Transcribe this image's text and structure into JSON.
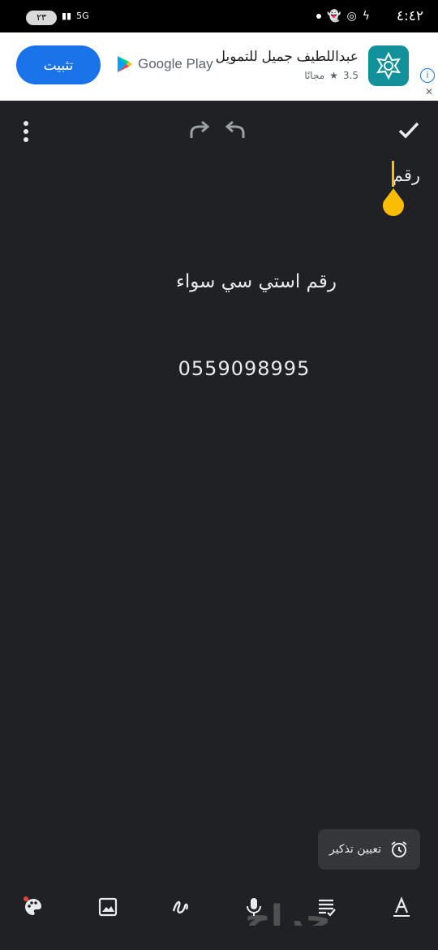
{
  "status_bar": {
    "time": "٤:٤٢",
    "battery": "٢٣",
    "network": "5G"
  },
  "ad": {
    "install_label": "تثبيت",
    "store_label": "Google Play",
    "app_name": "عبداللطيف جميل للتمويل",
    "rating": "3.5",
    "price": "مجانًا"
  },
  "note": {
    "title": "رقم",
    "line1": "رقم استي سي سواء",
    "line2": "0559098995"
  },
  "reminder": {
    "label": "تعيين تذكير"
  },
  "watermark": "حراج",
  "colors": {
    "background": "#202124",
    "accent_cursor": "#fbbc04",
    "ad_button": "#1a73e8"
  }
}
